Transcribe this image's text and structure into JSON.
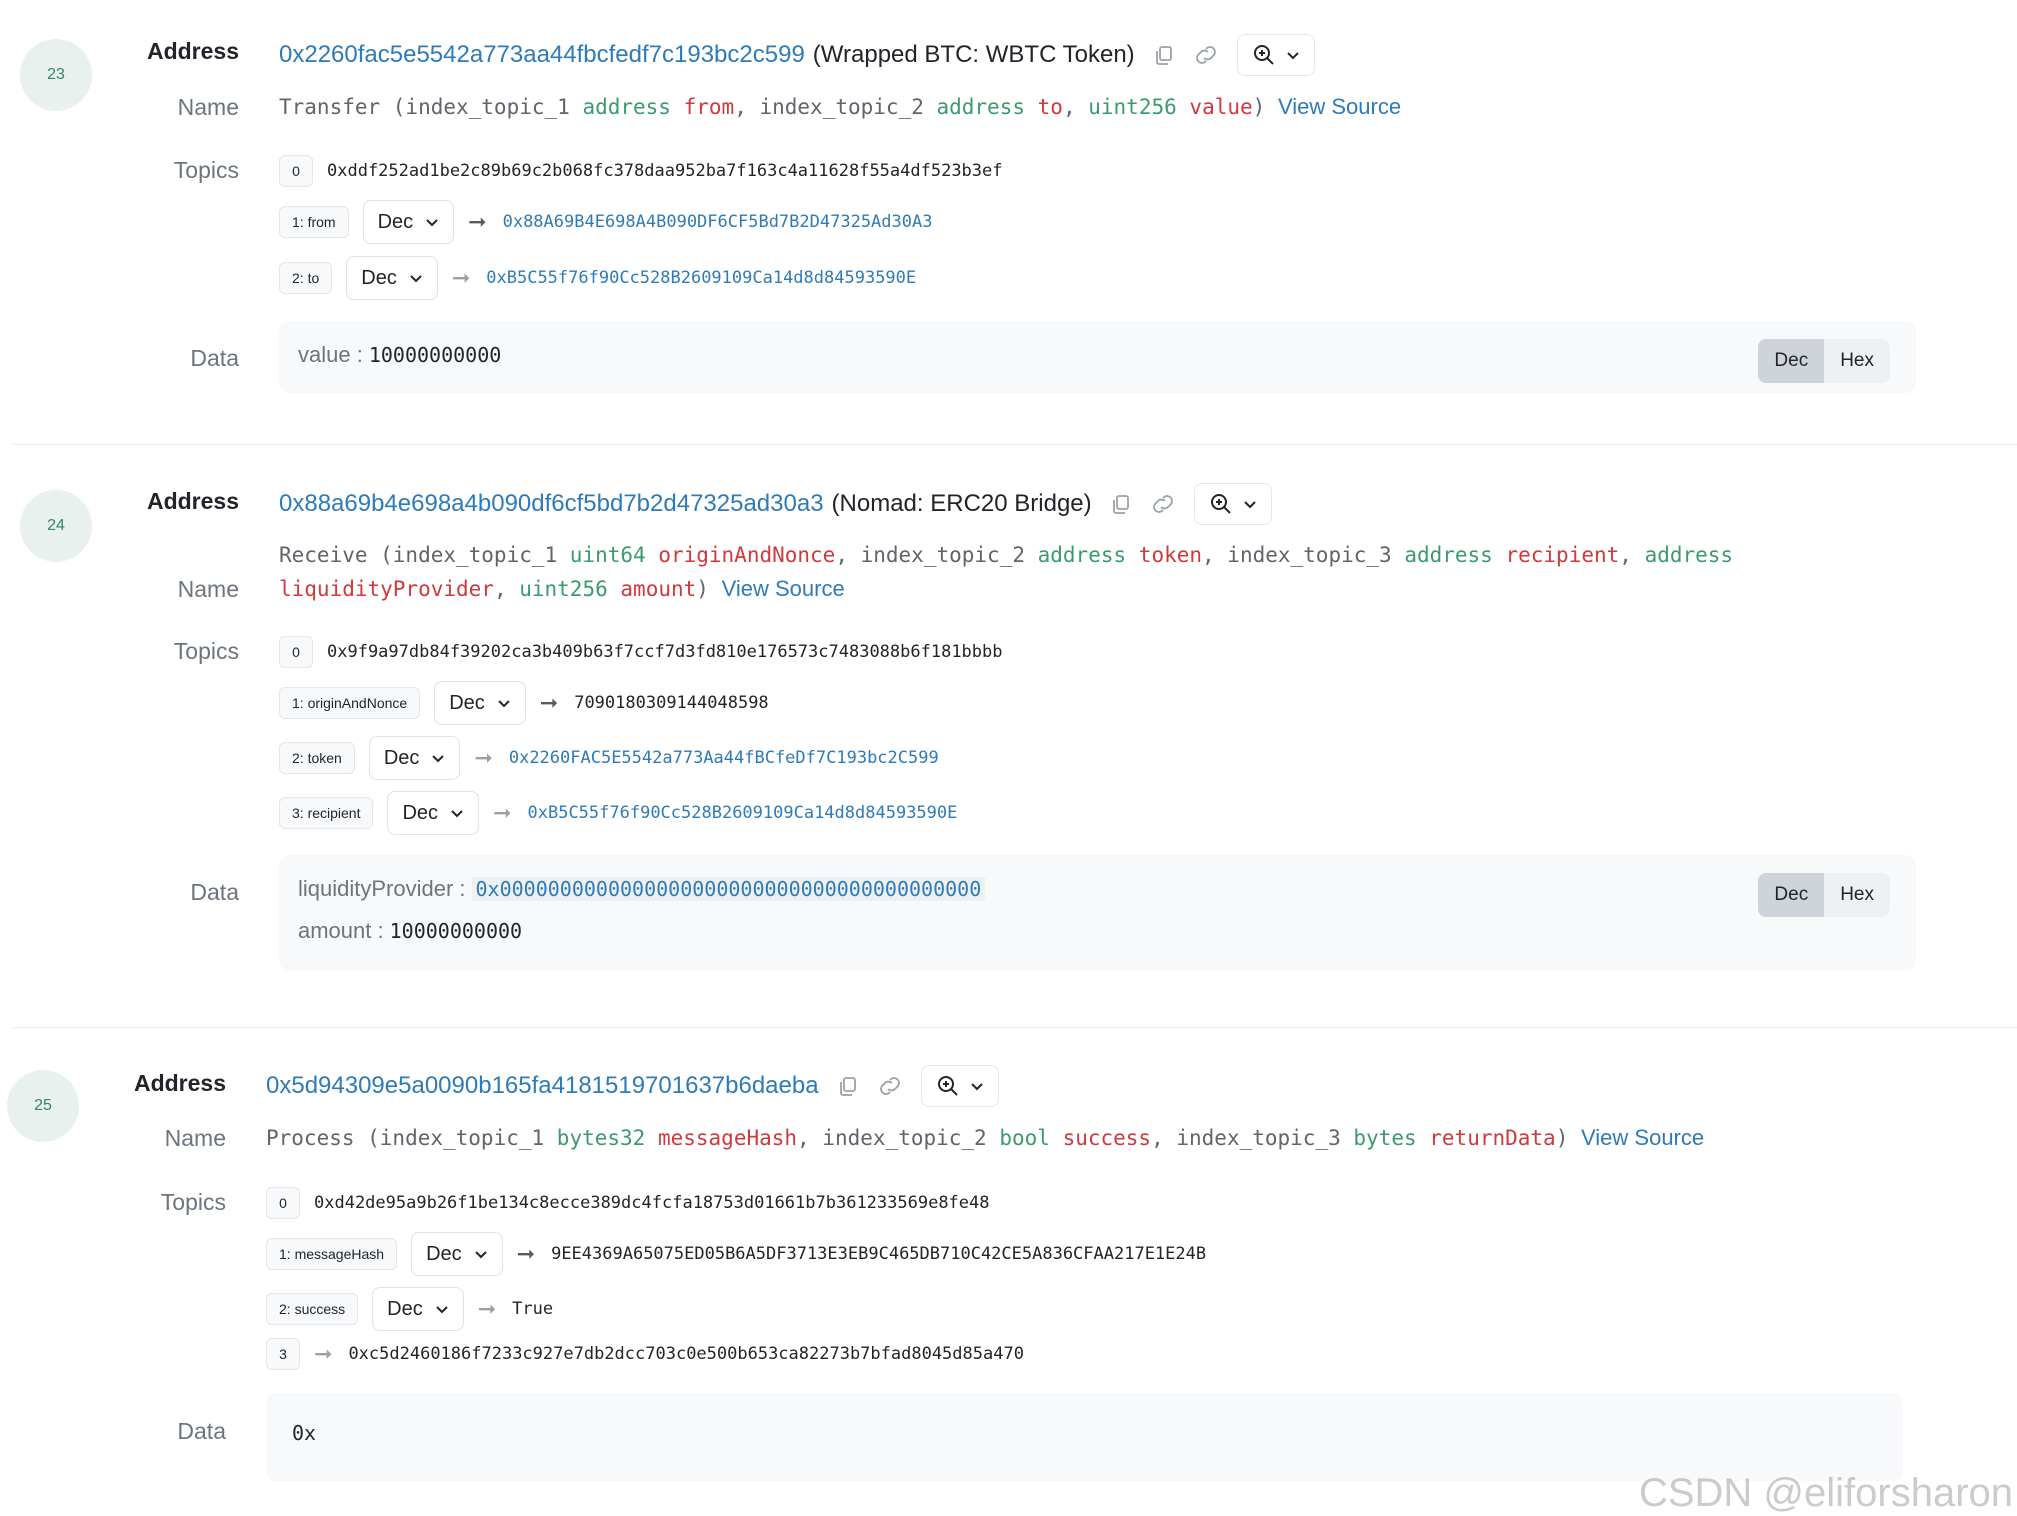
{
  "logs": [
    {
      "index": "23",
      "address_label": "Address",
      "address": "0x2260fac5e5542a773aa44fbcfedf7c193bc2c599",
      "address_tag": "(Wrapped BTC: WBTC Token)",
      "name_label": "Name",
      "sig_prefix": "Transfer (index_topic_1 ",
      "sig_p1_type": "address",
      "sig_p1_name": "from",
      "sig_mid1": ", index_topic_2 ",
      "sig_p2_type": "address",
      "sig_p2_name": "to",
      "sig_mid2": ", ",
      "sig_p3_type": "uint256",
      "sig_p3_name": "value",
      "sig_suffix": ")",
      "view_source": "View Source",
      "topics_label": "Topics",
      "topic0_idx": "0",
      "topic0": "0xddf252ad1be2c89b69c2b068fc378daa952ba7f163c4a11628f55a4df523b3ef",
      "topic1_badge": "1: from",
      "topic1_format": "Dec",
      "topic1_value": "0x88A69B4E698A4B090DF6CF5Bd7B2D47325Ad30A3",
      "topic2_badge": "2: to",
      "topic2_format": "Dec",
      "topic2_value": "0xB5C55f76f90Cc528B2609109Ca14d8d84593590E",
      "data_label": "Data",
      "data_key1": "value :",
      "data_val1": "10000000000",
      "toggle_dec": "Dec",
      "toggle_hex": "Hex"
    },
    {
      "index": "24",
      "address_label": "Address",
      "address": "0x88a69b4e698a4b090df6cf5bd7b2d47325ad30a3",
      "address_tag": "(Nomad: ERC20 Bridge)",
      "name_label": "Name",
      "sig_prefix": "Receive (index_topic_1 ",
      "sig_p1_type": "uint64",
      "sig_p1_name": "originAndNonce",
      "sig_mid1": ", index_topic_2 ",
      "sig_p2_type": "address",
      "sig_p2_name": "token",
      "sig_mid2": ", index_topic_3 ",
      "sig_p3_type": "address",
      "sig_p3_name": "recipient",
      "sig_mid3": ", ",
      "sig_p4_type": "address",
      "sig_line2_p4_name": "liquidityProvider",
      "sig_mid4": ", ",
      "sig_p5_type": "uint256",
      "sig_p5_name": "amount",
      "sig_suffix": ")",
      "view_source": "View Source",
      "topics_label": "Topics",
      "topic0_idx": "0",
      "topic0": "0x9f9a97db84f39202ca3b409b63f7ccf7d3fd810e176573c7483088b6f181bbbb",
      "topic1_badge": "1: originAndNonce",
      "topic1_format": "Dec",
      "topic1_value": "7090180309144048598",
      "topic2_badge": "2: token",
      "topic2_format": "Dec",
      "topic2_value": "0x2260FAC5E5542a773Aa44fBCfeDf7C193bc2C599",
      "topic3_badge": "3: recipient",
      "topic3_format": "Dec",
      "topic3_value": "0xB5C55f76f90Cc528B2609109Ca14d8d84593590E",
      "data_label": "Data",
      "data_key1": "liquidityProvider :",
      "data_val1": "0x0000000000000000000000000000000000000000",
      "data_key2": "amount :",
      "data_val2": "10000000000",
      "toggle_dec": "Dec",
      "toggle_hex": "Hex"
    },
    {
      "index": "25",
      "address_label": "Address",
      "address": "0x5d94309e5a0090b165fa4181519701637b6daeba",
      "name_label": "Name",
      "sig_prefix": "Process (index_topic_1 ",
      "sig_p1_type": "bytes32",
      "sig_p1_name": "messageHash",
      "sig_mid1": ", index_topic_2 ",
      "sig_p2_type": "bool",
      "sig_p2_name": "success",
      "sig_mid2": ", index_topic_3 ",
      "sig_p3_type": "bytes",
      "sig_p3_name": "returnData",
      "sig_suffix": ")",
      "view_source": "View Source",
      "topics_label": "Topics",
      "topic0_idx": "0",
      "topic0": "0xd42de95a9b26f1be134c8ecce389dc4fcfa18753d01661b7b361233569e8fe48",
      "topic1_badge": "1: messageHash",
      "topic1_format": "Dec",
      "topic1_value": "9EE4369A65075ED05B6A5DF3713E3EB9C465DB710C42CE5A836CFAA217E1E24B",
      "topic2_badge": "2: success",
      "topic2_format": "Dec",
      "topic2_value": "True",
      "topic3_idx": "3",
      "topic3_value": "0xc5d2460186f7233c927e7db2dcc703c0e500b653ca82273b7bfad8045d85a470",
      "data_label": "Data",
      "data_val1": "0x"
    }
  ],
  "watermark": "CSDN @eliforsharon"
}
